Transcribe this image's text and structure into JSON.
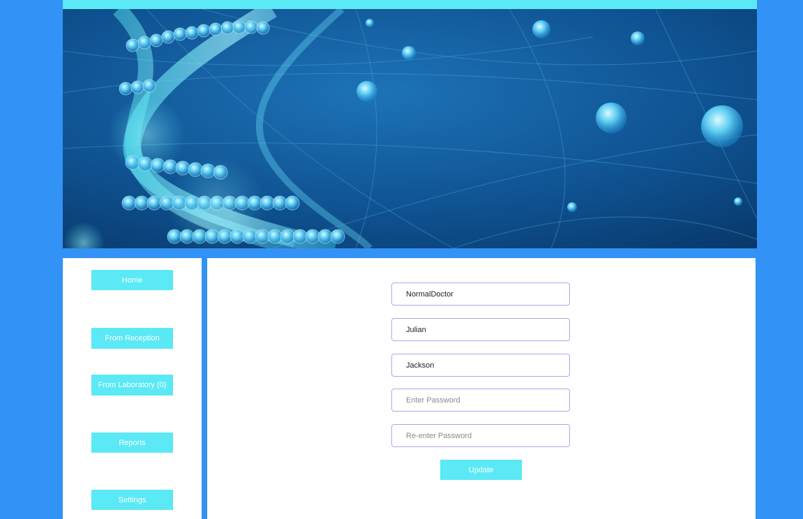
{
  "colors": {
    "page_background": "#3392f5",
    "accent_cyan": "#5ae9f5",
    "panel_background": "#ffffff",
    "field_border": "#a9a9ee"
  },
  "banner": {
    "image": "dna-helix-illustration"
  },
  "sidebar": {
    "items": [
      {
        "label": "Home"
      },
      {
        "label": "From Reception"
      },
      {
        "label": "From Laboratory (0)"
      },
      {
        "label": "Reports"
      },
      {
        "label": "Settings"
      }
    ]
  },
  "form": {
    "username": {
      "value": "NormalDoctor"
    },
    "first_name": {
      "value": "Julian"
    },
    "last_name": {
      "value": "Jackson"
    },
    "password": {
      "value": "",
      "placeholder": "Enter Password"
    },
    "password_confirm": {
      "value": "",
      "placeholder": "Re-enter Password"
    },
    "submit_label": "Update"
  }
}
